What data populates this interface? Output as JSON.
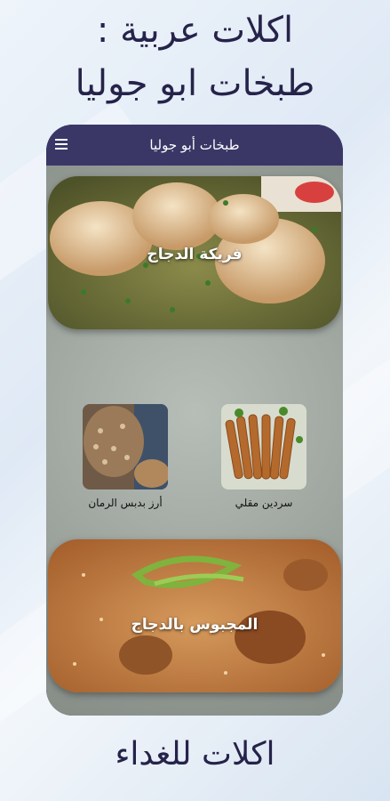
{
  "promo": {
    "line1": "اكلات عربية :",
    "line2": "طبخات ابو جوليا",
    "footer": "اكلات للغداء"
  },
  "appbar": {
    "title": "طبخات أبو جوليا",
    "menu_icon": "hamburger-menu-icon"
  },
  "recipes": {
    "freekeh": {
      "label": "فريكة الدجاج"
    },
    "rice_pomegranate": {
      "label": "أرز بدبس الرمان"
    },
    "fried_sardine": {
      "label": "سردين مقلي"
    },
    "majboos": {
      "label": "المجبوس بالدجاج"
    }
  },
  "colors": {
    "appbar": "#3a3767",
    "phone_frame": "#2a2850",
    "promo_text": "#26234a"
  }
}
